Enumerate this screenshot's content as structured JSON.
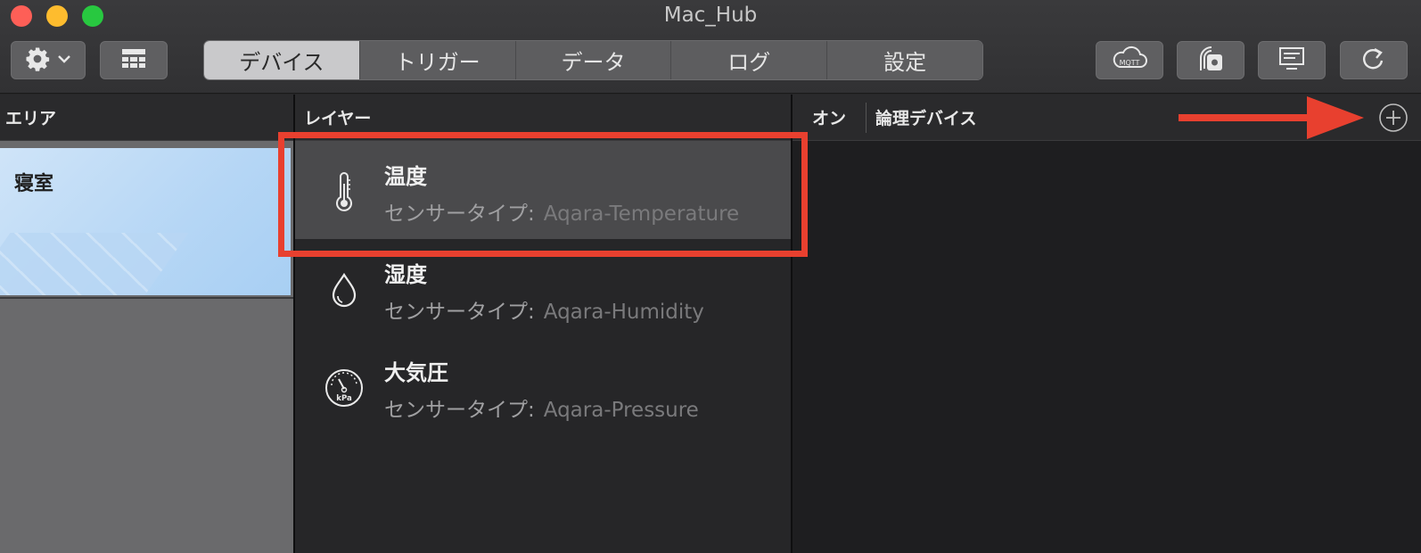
{
  "window": {
    "title": "Mac_Hub"
  },
  "toolbar": {
    "tabs": [
      {
        "label": "デバイス",
        "active": true
      },
      {
        "label": "トリガー",
        "active": false
      },
      {
        "label": "データ",
        "active": false
      },
      {
        "label": "ログ",
        "active": false
      },
      {
        "label": "設定",
        "active": false
      }
    ],
    "mqtt_label": "MQTT"
  },
  "columns": {
    "area": "エリア",
    "layer": "レイヤー",
    "on": "オン",
    "logical_device": "論理デバイス"
  },
  "areas": [
    {
      "name": "寝室"
    }
  ],
  "layers": [
    {
      "name": "温度",
      "sensor_label": "センサータイプ:",
      "sensor_type": "Aqara-Temperature",
      "icon": "thermometer-icon",
      "selected": true
    },
    {
      "name": "湿度",
      "sensor_label": "センサータイプ:",
      "sensor_type": "Aqara-Humidity",
      "icon": "droplet-icon",
      "selected": false
    },
    {
      "name": "大気圧",
      "sensor_label": "センサータイプ:",
      "sensor_type": "Aqara-Pressure",
      "icon": "pressure-gauge-icon",
      "icon_text": "kPa",
      "selected": false
    }
  ],
  "colors": {
    "annotation": "#e8402f",
    "active_tab": "#c9c9cb",
    "selected_row": "#4a4a4c"
  }
}
